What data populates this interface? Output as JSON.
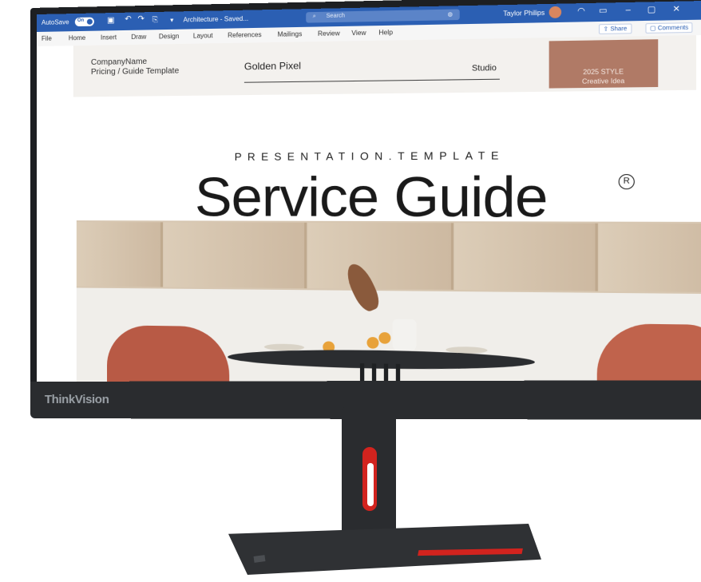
{
  "window": {
    "autosave_label": "AutoSave",
    "autosave_state": "On",
    "doc_title": "Architecture - Saved...",
    "search_placeholder": "Search",
    "user_name": "Taylor Philips",
    "min_glyph": "–",
    "max_glyph": "▢",
    "close_glyph": "✕"
  },
  "ribbon": {
    "tabs": [
      "File",
      "Home",
      "Insert",
      "Draw",
      "Design",
      "Layout",
      "References",
      "Mailings",
      "Review",
      "View",
      "Help"
    ],
    "share_label": "Share",
    "comments_label": "Comments"
  },
  "document": {
    "header": {
      "company": "CompanyName",
      "template_line": "Pricing / Guide Template",
      "golden": "Golden Pixel",
      "studio": "Studio",
      "style_line1": "2025 STYLE",
      "style_line2": "Creative Idea"
    },
    "presentation_label": "PRESENTATION.TEMPLATE",
    "main_title": "Service Guide",
    "registered_mark": "R"
  },
  "monitor": {
    "brand": "ThinkVision"
  },
  "colors": {
    "titlebar": "#2b5fb3",
    "accent_box": "#b07a66",
    "stand_red": "#d2231e"
  }
}
